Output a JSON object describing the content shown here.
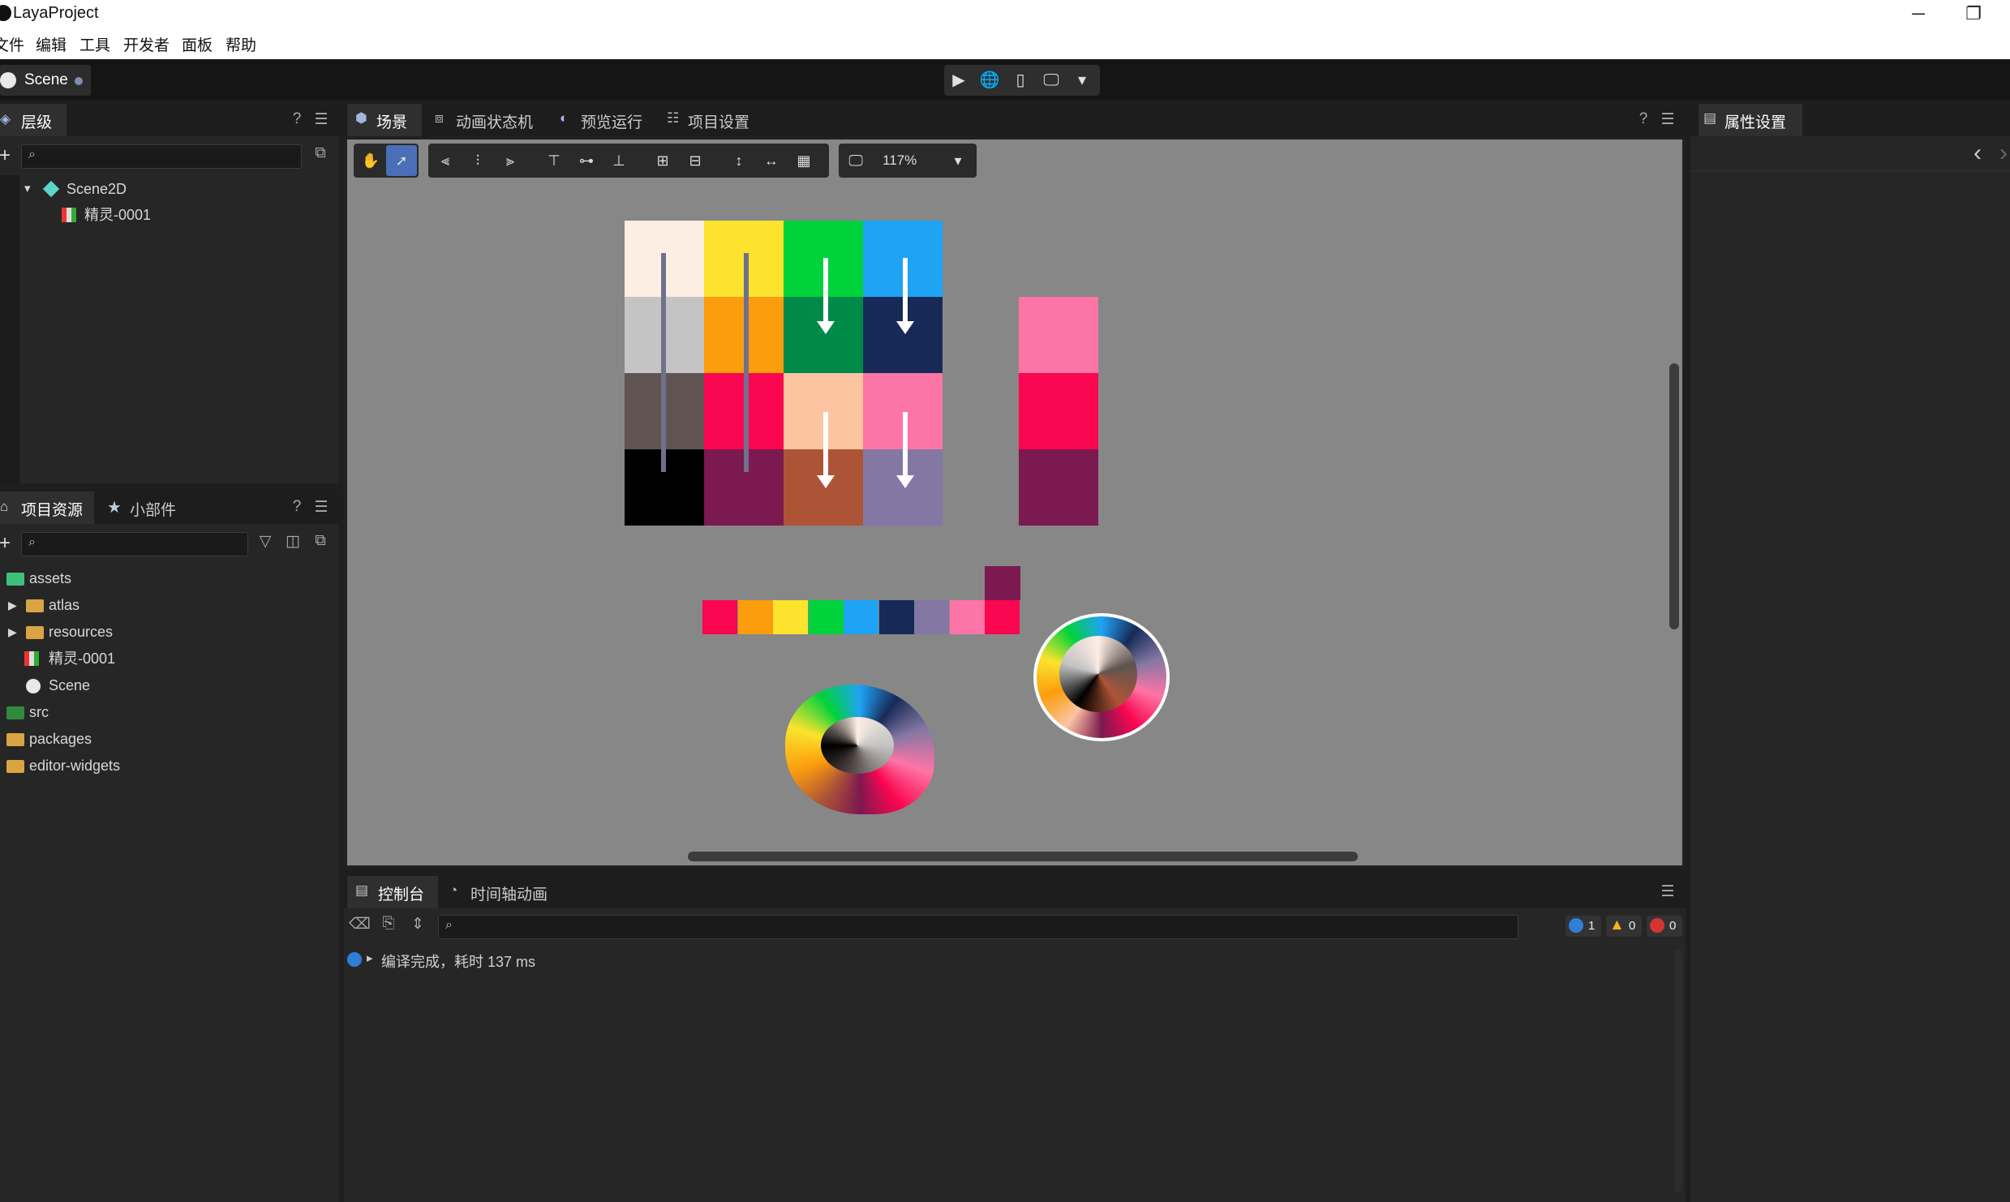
{
  "window": {
    "title": "LayaProject",
    "minimize": "─",
    "maximize": "❐"
  },
  "menu": [
    "文件",
    "编辑",
    "工具",
    "开发者",
    "面板",
    "帮助"
  ],
  "scene_tab": {
    "label": "Scene"
  },
  "play_controls": {
    "play": "▶",
    "web": "🌐",
    "mobile": "▯",
    "desktop": "🖵",
    "more": "▾"
  },
  "hierarchy": {
    "title": "层级",
    "help": "?",
    "menu": "☰",
    "add": "+",
    "search_placeholder": "",
    "items": [
      {
        "label": "Scene2D",
        "expander": "▾"
      },
      {
        "label": "精灵-0001"
      }
    ]
  },
  "assets_panel": {
    "tab_project": "项目资源",
    "tab_widgets": "小部件",
    "help": "?",
    "menu": "☰",
    "add": "+",
    "items": [
      {
        "label": "assets"
      },
      {
        "label": "atlas",
        "expander": "▶"
      },
      {
        "label": "resources",
        "expander": "▶"
      },
      {
        "label": "精灵-0001"
      },
      {
        "label": "Scene"
      },
      {
        "label": "src"
      },
      {
        "label": "packages"
      },
      {
        "label": "editor-widgets"
      }
    ]
  },
  "editor_tabs": [
    "场景",
    "动画状态机",
    "预览运行",
    "项目设置"
  ],
  "editor_help": "?",
  "editor_menu": "☰",
  "toolbar": {
    "zoom": "117%",
    "zoom_dropdown": "▾"
  },
  "inspector": {
    "title": "属性设置",
    "back": "‹",
    "forward": "›"
  },
  "console": {
    "tab_console": "控制台",
    "tab_timeline": "时间轴动画",
    "menu": "☰",
    "search_placeholder": "",
    "info_count": "1",
    "warn_count": "0",
    "error_count": "0",
    "log": [
      {
        "expander": "▸",
        "text": "编译完成，耗时 137 ms"
      }
    ]
  },
  "palette": {
    "grid": [
      [
        "#fdeee4",
        "#fbe32e",
        "#00d23c",
        "#1fa3f5"
      ],
      [
        "#c4c4c4",
        "#fb9d0c",
        "#008a48",
        "#172a57"
      ],
      [
        "#5f5452",
        "#fb0650",
        "#fdc4a2",
        "#fd75a6"
      ],
      [
        "#000000",
        "#7c1950",
        "#ae5436",
        "#8477a4"
      ]
    ],
    "column": [
      "#fd75a6",
      "#fb0650",
      "#7c1950"
    ],
    "strip": [
      "#fb0650",
      "#fb9d0c",
      "#fbe32e",
      "#00d23c",
      "#1fa3f5",
      "#172a57",
      "#8477a4",
      "#fd75a6",
      "#fb0650"
    ],
    "strip_top": "#7c1950"
  }
}
